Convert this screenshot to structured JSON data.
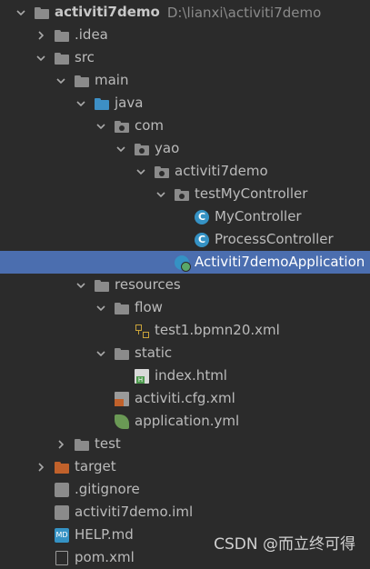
{
  "colors": {
    "background": "#2b2b2b",
    "selection": "#4b6eaf",
    "folder": "#8b8b8b",
    "source_folder": "#3d8fc5",
    "excluded_folder": "#c0612b",
    "class_icon": "#3592c4"
  },
  "tree": [
    {
      "id": "root",
      "label": "activiti7demo",
      "path": "D:\\lianxi\\activiti7demo",
      "arrow": "down",
      "icon": "module-folder-icon",
      "bold": true,
      "depth": 0
    },
    {
      "id": "idea",
      "label": ".idea",
      "arrow": "right",
      "icon": "folder-icon",
      "depth": 1
    },
    {
      "id": "src",
      "label": "src",
      "arrow": "down",
      "icon": "folder-icon",
      "depth": 1
    },
    {
      "id": "main",
      "label": "main",
      "arrow": "down",
      "icon": "folder-icon",
      "depth": 2
    },
    {
      "id": "java",
      "label": "java",
      "arrow": "down",
      "icon": "source-folder-icon",
      "depth": 3
    },
    {
      "id": "com",
      "label": "com",
      "arrow": "down",
      "icon": "package-icon",
      "depth": 4
    },
    {
      "id": "yao",
      "label": "yao",
      "arrow": "down",
      "icon": "package-icon",
      "depth": 5
    },
    {
      "id": "activiti7demo_pkg",
      "label": "activiti7demo",
      "arrow": "down",
      "icon": "package-icon",
      "depth": 6
    },
    {
      "id": "testMyController",
      "label": "testMyController",
      "arrow": "down",
      "icon": "package-icon",
      "depth": 7
    },
    {
      "id": "MyController",
      "label": "MyController",
      "arrow": "none",
      "icon": "class-icon",
      "depth": 8
    },
    {
      "id": "ProcessController",
      "label": "ProcessController",
      "arrow": "none",
      "icon": "class-icon",
      "depth": 8
    },
    {
      "id": "Activiti7demoApplication",
      "label": "Activiti7demoApplication",
      "arrow": "none",
      "icon": "spring-boot-app-icon",
      "depth": 7,
      "selected": true
    },
    {
      "id": "resources",
      "label": "resources",
      "arrow": "down",
      "icon": "resources-folder-icon",
      "depth": 3
    },
    {
      "id": "flow",
      "label": "flow",
      "arrow": "down",
      "icon": "folder-icon",
      "depth": 4
    },
    {
      "id": "test1bpmn",
      "label": "test1.bpmn20.xml",
      "arrow": "none",
      "icon": "bpmn-file-icon",
      "depth": 5
    },
    {
      "id": "static",
      "label": "static",
      "arrow": "down",
      "icon": "folder-icon",
      "depth": 4
    },
    {
      "id": "indexhtml",
      "label": "index.html",
      "arrow": "none",
      "icon": "html-file-icon",
      "depth": 5
    },
    {
      "id": "activiticfg",
      "label": "activiti.cfg.xml",
      "arrow": "none",
      "icon": "xml-file-icon",
      "depth": 4
    },
    {
      "id": "applicationyml",
      "label": "application.yml",
      "arrow": "none",
      "icon": "spring-yml-icon",
      "depth": 4
    },
    {
      "id": "test",
      "label": "test",
      "arrow": "right",
      "icon": "folder-icon",
      "depth": 2
    },
    {
      "id": "target",
      "label": "target",
      "arrow": "right",
      "icon": "excluded-folder-icon",
      "depth": 1
    },
    {
      "id": "gitignore",
      "label": ".gitignore",
      "arrow": "none",
      "icon": "gitignore-icon",
      "depth": 1
    },
    {
      "id": "iml",
      "label": "activiti7demo.iml",
      "arrow": "none",
      "icon": "iml-file-icon",
      "depth": 1
    },
    {
      "id": "helpmd",
      "label": "HELP.md",
      "arrow": "none",
      "icon": "markdown-icon",
      "depth": 1
    },
    {
      "id": "pomxml",
      "label": "pom.xml",
      "arrow": "none",
      "icon": "maven-icon",
      "depth": 1
    }
  ],
  "watermark": "CSDN @而立终可得"
}
